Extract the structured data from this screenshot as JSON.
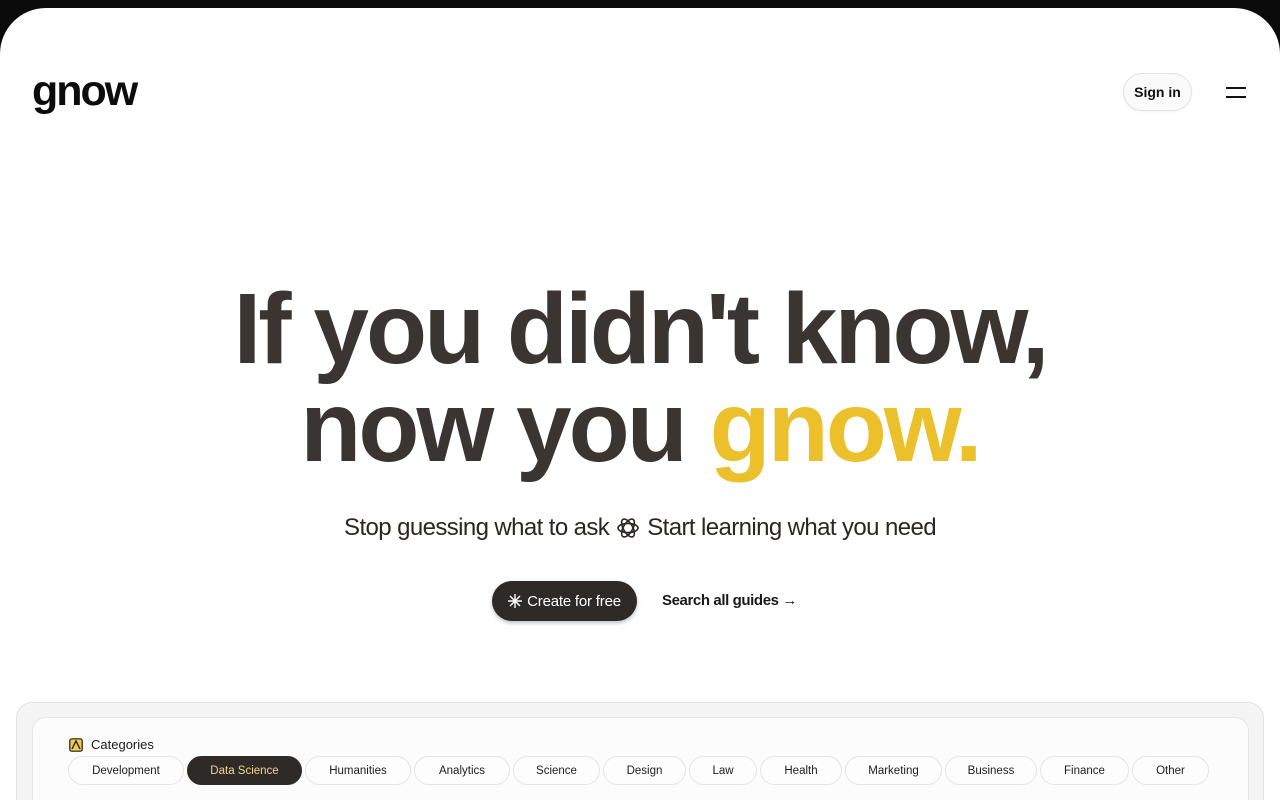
{
  "header": {
    "logo": "gnow",
    "sign_in": "Sign in"
  },
  "hero": {
    "line1": "If you didn't know,",
    "line2_prefix": "now you",
    "line2_accent": "gnow."
  },
  "subtitle": {
    "left": "Stop guessing what to ask",
    "right": "Start learning what you need"
  },
  "actions": {
    "create": "Create for free",
    "search": "Search all guides →"
  },
  "categories": {
    "heading": "Categories",
    "active_index": 1,
    "items": [
      {
        "label": "Development"
      },
      {
        "label": "Data Science"
      },
      {
        "label": "Humanities"
      },
      {
        "label": "Analytics"
      },
      {
        "label": "Science"
      },
      {
        "label": "Design"
      },
      {
        "label": "Law"
      },
      {
        "label": "Health"
      },
      {
        "label": "Marketing"
      },
      {
        "label": "Business"
      },
      {
        "label": "Finance"
      },
      {
        "label": "Other"
      }
    ]
  },
  "colors": {
    "accent": "#ecc02a",
    "dark": "#2e2a27",
    "active_chip_text": "#f2d48a"
  }
}
